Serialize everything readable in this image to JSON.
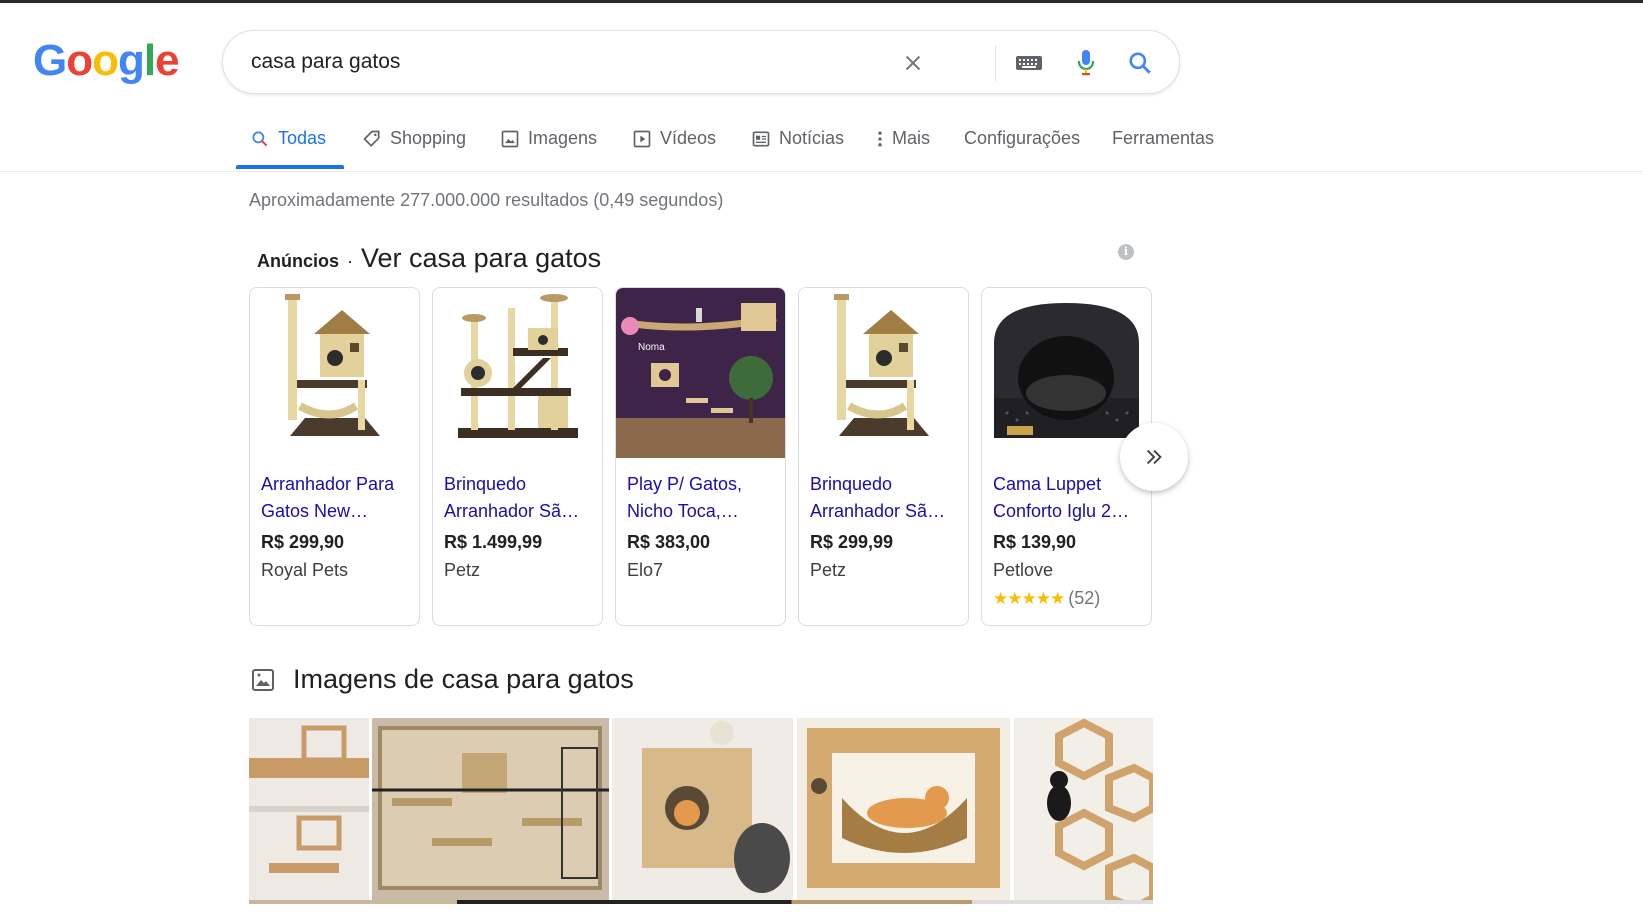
{
  "logo": {
    "letters": [
      "G",
      "o",
      "o",
      "g",
      "l",
      "e"
    ],
    "colors": [
      "#4285F4",
      "#EA4335",
      "#FBBC05",
      "#4285F4",
      "#34A853",
      "#EA4335"
    ]
  },
  "search": {
    "query": "casa para gatos",
    "icons": [
      "clear-icon",
      "keyboard-icon",
      "microphone-icon",
      "search-icon"
    ]
  },
  "tabs": [
    {
      "label": "Todas",
      "icon": "search-icon",
      "active": true
    },
    {
      "label": "Shopping",
      "icon": "tag-icon"
    },
    {
      "label": "Imagens",
      "icon": "image-icon"
    },
    {
      "label": "Vídeos",
      "icon": "video-icon"
    },
    {
      "label": "Notícias",
      "icon": "news-icon"
    },
    {
      "label": "Mais",
      "icon": "more-vert-icon"
    },
    {
      "label": "Configurações"
    },
    {
      "label": "Ferramentas"
    }
  ],
  "stats": "Aproximadamente 277.000.000 resultados (0,49 segundos)",
  "ads": {
    "label": "Anúncios",
    "separator": "·",
    "title": "Ver casa para gatos",
    "products": [
      {
        "title": "Arranhador Para Gatos New…",
        "price": "R$ 299,90",
        "store": "Royal Pets",
        "image": "cat-tree-house"
      },
      {
        "title": "Brinquedo Arranhador Sã…",
        "price": "R$ 1.499,99",
        "store": "Petz",
        "image": "cat-tree-tall"
      },
      {
        "title": "Play P/ Gatos, Nicho Toca,…",
        "price": "R$ 383,00",
        "store": "Elo7",
        "image": "wall-shelves-purple"
      },
      {
        "title": "Brinquedo Arranhador Sã…",
        "price": "R$ 299,99",
        "store": "Petz",
        "image": "cat-tree-house"
      },
      {
        "title": "Cama Luppet Conforto Iglu 2…",
        "price": "R$ 139,90",
        "store": "Petlove",
        "image": "igloo-bed",
        "rating": 5,
        "reviews": "(52)"
      }
    ]
  },
  "images_section": {
    "title": "Imagens de casa para gatos",
    "icon": "image-icon"
  },
  "colors": {
    "accent": "#1a73e8",
    "link": "#1a0dab",
    "muted": "#70757a",
    "star": "#fbbc04"
  }
}
